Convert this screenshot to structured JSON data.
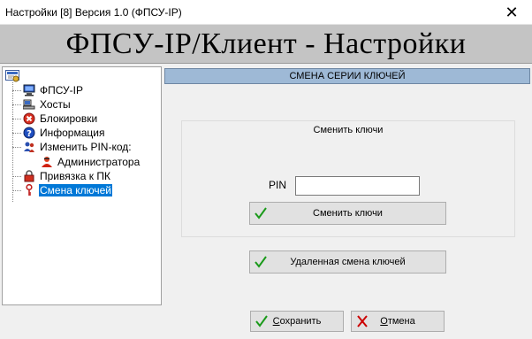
{
  "window": {
    "title": "Настройки [8] Версия 1.0 (ФПСУ-IP)",
    "close_glyph": "✕"
  },
  "banner": {
    "text": "ФПСУ-IP/Клиент - Настройки"
  },
  "tree": {
    "items": [
      {
        "label": "ФПСУ-IP",
        "icon": "computer-icon"
      },
      {
        "label": "Хосты",
        "icon": "hosts-icon"
      },
      {
        "label": "Блокировки",
        "icon": "block-icon"
      },
      {
        "label": "Информация",
        "icon": "info-icon"
      },
      {
        "label": "Изменить PIN-код:",
        "icon": "users-icon"
      },
      {
        "label": "Администратора",
        "icon": "admin-icon"
      },
      {
        "label": "Привязка к ПК",
        "icon": "lock-icon"
      },
      {
        "label": "Смена ключей",
        "icon": "key-icon",
        "selected": true
      }
    ]
  },
  "panel": {
    "header": "СМЕНА СЕРИИ КЛЮЧЕЙ",
    "group_title": "Сменить ключи",
    "pin_label": "PIN",
    "pin_value": "",
    "change_button": "Сменить ключи",
    "remote_button": "Удаленная смена ключей"
  },
  "footer": {
    "save_first": "С",
    "save_rest": "охранить",
    "cancel_first": "О",
    "cancel_rest": "тмена"
  },
  "colors": {
    "header_bg": "#9eb9d6",
    "selection": "#0078d7",
    "check_green": "#1a9a1a",
    "cancel_red": "#cc0000"
  }
}
